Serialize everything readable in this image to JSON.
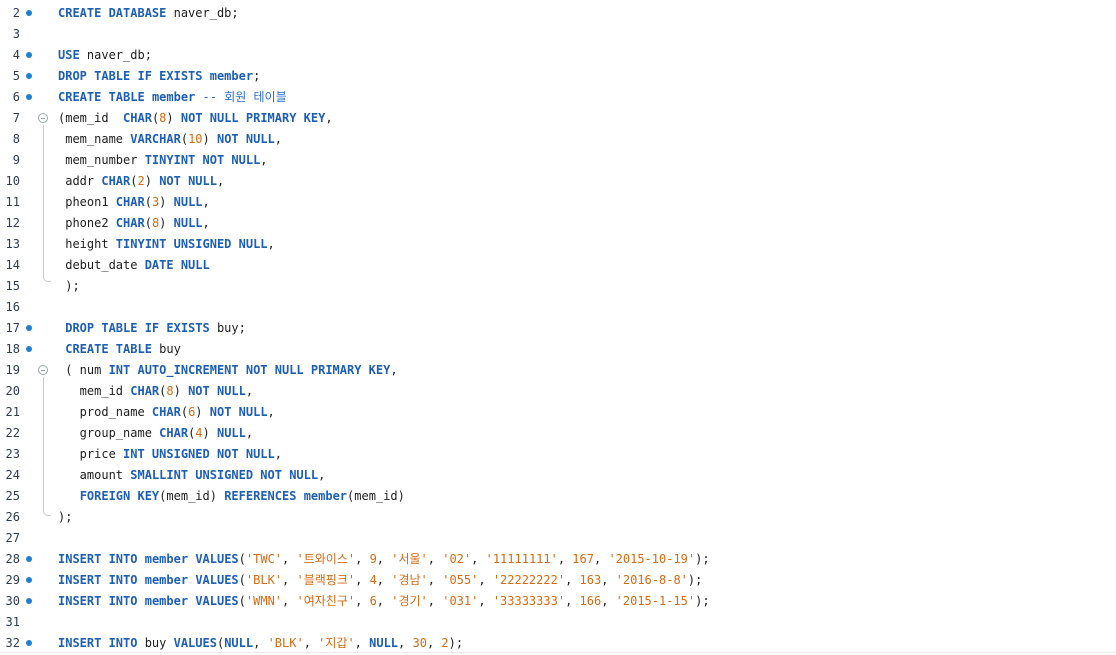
{
  "editor": {
    "lines": [
      {
        "n": "2",
        "tokens": [
          [
            "kw",
            "CREATE DATABASE"
          ],
          [
            "t",
            " naver_db;"
          ]
        ]
      },
      {
        "n": "3",
        "tokens": []
      },
      {
        "n": "4",
        "tokens": [
          [
            "kw",
            "USE"
          ],
          [
            "t",
            " naver_db;"
          ]
        ]
      },
      {
        "n": "5",
        "tokens": [
          [
            "kw",
            "DROP TABLE IF EXISTS"
          ],
          [
            "t",
            " "
          ],
          [
            "kw",
            "member"
          ],
          [
            "t",
            ";"
          ]
        ]
      },
      {
        "n": "6",
        "tokens": [
          [
            "kw",
            "CREATE TABLE"
          ],
          [
            "t",
            " "
          ],
          [
            "kw",
            "member"
          ],
          [
            "t",
            " "
          ],
          [
            "cm",
            "-- 회원 테이블"
          ]
        ]
      },
      {
        "n": "7",
        "tokens": [
          [
            "t",
            "(mem_id  "
          ],
          [
            "kw",
            "CHAR"
          ],
          [
            "t",
            "("
          ],
          [
            "num",
            "8"
          ],
          [
            "t",
            ") "
          ],
          [
            "kw",
            "NOT NULL PRIMARY KEY"
          ],
          [
            "t",
            ","
          ]
        ]
      },
      {
        "n": "8",
        "tokens": [
          [
            "t",
            " mem_name "
          ],
          [
            "kw",
            "VARCHAR"
          ],
          [
            "t",
            "("
          ],
          [
            "num",
            "10"
          ],
          [
            "t",
            ") "
          ],
          [
            "kw",
            "NOT NULL"
          ],
          [
            "t",
            ","
          ]
        ]
      },
      {
        "n": "9",
        "tokens": [
          [
            "t",
            " mem_number "
          ],
          [
            "kw",
            "TINYINT NOT NULL"
          ],
          [
            "t",
            ","
          ]
        ]
      },
      {
        "n": "10",
        "tokens": [
          [
            "t",
            " addr "
          ],
          [
            "kw",
            "CHAR"
          ],
          [
            "t",
            "("
          ],
          [
            "num",
            "2"
          ],
          [
            "t",
            ") "
          ],
          [
            "kw",
            "NOT NULL"
          ],
          [
            "t",
            ","
          ]
        ]
      },
      {
        "n": "11",
        "tokens": [
          [
            "t",
            " pheon1 "
          ],
          [
            "kw",
            "CHAR"
          ],
          [
            "t",
            "("
          ],
          [
            "num",
            "3"
          ],
          [
            "t",
            ") "
          ],
          [
            "kw",
            "NULL"
          ],
          [
            "t",
            ","
          ]
        ]
      },
      {
        "n": "12",
        "tokens": [
          [
            "t",
            " phone2 "
          ],
          [
            "kw",
            "CHAR"
          ],
          [
            "t",
            "("
          ],
          [
            "num",
            "8"
          ],
          [
            "t",
            ") "
          ],
          [
            "kw",
            "NULL"
          ],
          [
            "t",
            ","
          ]
        ]
      },
      {
        "n": "13",
        "tokens": [
          [
            "t",
            " height "
          ],
          [
            "kw",
            "TINYINT UNSIGNED NULL"
          ],
          [
            "t",
            ","
          ]
        ]
      },
      {
        "n": "14",
        "tokens": [
          [
            "t",
            " debut_date "
          ],
          [
            "kw",
            "DATE NULL"
          ]
        ]
      },
      {
        "n": "15",
        "tokens": [
          [
            "t",
            " );"
          ]
        ]
      },
      {
        "n": "16",
        "tokens": []
      },
      {
        "n": "17",
        "tokens": [
          [
            "t",
            " "
          ],
          [
            "kw",
            "DROP TABLE IF EXISTS"
          ],
          [
            "t",
            " buy;"
          ]
        ]
      },
      {
        "n": "18",
        "tokens": [
          [
            "t",
            " "
          ],
          [
            "kw",
            "CREATE TABLE"
          ],
          [
            "t",
            " buy"
          ]
        ]
      },
      {
        "n": "19",
        "tokens": [
          [
            "t",
            " ( num "
          ],
          [
            "kw",
            "INT AUTO_INCREMENT NOT NULL PRIMARY KEY"
          ],
          [
            "t",
            ","
          ]
        ]
      },
      {
        "n": "20",
        "tokens": [
          [
            "t",
            "   mem_id "
          ],
          [
            "kw",
            "CHAR"
          ],
          [
            "t",
            "("
          ],
          [
            "num",
            "8"
          ],
          [
            "t",
            ") "
          ],
          [
            "kw",
            "NOT NULL"
          ],
          [
            "t",
            ","
          ]
        ]
      },
      {
        "n": "21",
        "tokens": [
          [
            "t",
            "   prod_name "
          ],
          [
            "kw",
            "CHAR"
          ],
          [
            "t",
            "("
          ],
          [
            "num",
            "6"
          ],
          [
            "t",
            ") "
          ],
          [
            "kw",
            "NOT NULL"
          ],
          [
            "t",
            ","
          ]
        ]
      },
      {
        "n": "22",
        "tokens": [
          [
            "t",
            "   group_name "
          ],
          [
            "kw",
            "CHAR"
          ],
          [
            "t",
            "("
          ],
          [
            "num",
            "4"
          ],
          [
            "t",
            ") "
          ],
          [
            "kw",
            "NULL"
          ],
          [
            "t",
            ","
          ]
        ]
      },
      {
        "n": "23",
        "tokens": [
          [
            "t",
            "   price "
          ],
          [
            "kw",
            "INT UNSIGNED NOT NULL"
          ],
          [
            "t",
            ","
          ]
        ]
      },
      {
        "n": "24",
        "tokens": [
          [
            "t",
            "   amount "
          ],
          [
            "kw",
            "SMALLINT UNSIGNED NOT NULL"
          ],
          [
            "t",
            ","
          ]
        ]
      },
      {
        "n": "25",
        "tokens": [
          [
            "t",
            "   "
          ],
          [
            "kw",
            "FOREIGN KEY"
          ],
          [
            "t",
            "(mem_id) "
          ],
          [
            "kw",
            "REFERENCES"
          ],
          [
            "t",
            " "
          ],
          [
            "kw",
            "member"
          ],
          [
            "t",
            "(mem_id)"
          ]
        ]
      },
      {
        "n": "26",
        "tokens": [
          [
            "t",
            ");"
          ]
        ]
      },
      {
        "n": "27",
        "tokens": []
      },
      {
        "n": "28",
        "tokens": [
          [
            "kw",
            "INSERT INTO"
          ],
          [
            "t",
            " "
          ],
          [
            "kw",
            "member"
          ],
          [
            "t",
            " "
          ],
          [
            "kw",
            "VALUES"
          ],
          [
            "t",
            "("
          ],
          [
            "str",
            "'TWC'"
          ],
          [
            "t",
            ", "
          ],
          [
            "str",
            "'트와이스'"
          ],
          [
            "t",
            ", "
          ],
          [
            "num",
            "9"
          ],
          [
            "t",
            ", "
          ],
          [
            "str",
            "'서울'"
          ],
          [
            "t",
            ", "
          ],
          [
            "str",
            "'02'"
          ],
          [
            "t",
            ", "
          ],
          [
            "str",
            "'11111111'"
          ],
          [
            "t",
            ", "
          ],
          [
            "num",
            "167"
          ],
          [
            "t",
            ", "
          ],
          [
            "str",
            "'2015-10-19'"
          ],
          [
            "t",
            ");"
          ]
        ]
      },
      {
        "n": "29",
        "tokens": [
          [
            "kw",
            "INSERT INTO"
          ],
          [
            "t",
            " "
          ],
          [
            "kw",
            "member"
          ],
          [
            "t",
            " "
          ],
          [
            "kw",
            "VALUES"
          ],
          [
            "t",
            "("
          ],
          [
            "str",
            "'BLK'"
          ],
          [
            "t",
            ", "
          ],
          [
            "str",
            "'블랙핑크'"
          ],
          [
            "t",
            ", "
          ],
          [
            "num",
            "4"
          ],
          [
            "t",
            ", "
          ],
          [
            "str",
            "'경남'"
          ],
          [
            "t",
            ", "
          ],
          [
            "str",
            "'055'"
          ],
          [
            "t",
            ", "
          ],
          [
            "str",
            "'22222222'"
          ],
          [
            "t",
            ", "
          ],
          [
            "num",
            "163"
          ],
          [
            "t",
            ", "
          ],
          [
            "str",
            "'2016-8-8'"
          ],
          [
            "t",
            ");"
          ]
        ]
      },
      {
        "n": "30",
        "tokens": [
          [
            "kw",
            "INSERT INTO"
          ],
          [
            "t",
            " "
          ],
          [
            "kw",
            "member"
          ],
          [
            "t",
            " "
          ],
          [
            "kw",
            "VALUES"
          ],
          [
            "t",
            "("
          ],
          [
            "str",
            "'WMN'"
          ],
          [
            "t",
            ", "
          ],
          [
            "str",
            "'여자친구'"
          ],
          [
            "t",
            ", "
          ],
          [
            "num",
            "6"
          ],
          [
            "t",
            ", "
          ],
          [
            "str",
            "'경기'"
          ],
          [
            "t",
            ", "
          ],
          [
            "str",
            "'031'"
          ],
          [
            "t",
            ", "
          ],
          [
            "str",
            "'33333333'"
          ],
          [
            "t",
            ", "
          ],
          [
            "num",
            "166"
          ],
          [
            "t",
            ", "
          ],
          [
            "str",
            "'2015-1-15'"
          ],
          [
            "t",
            ");"
          ]
        ]
      },
      {
        "n": "31",
        "tokens": []
      },
      {
        "n": "32",
        "tokens": [
          [
            "kw",
            "INSERT INTO"
          ],
          [
            "t",
            " buy "
          ],
          [
            "kw",
            "VALUES"
          ],
          [
            "t",
            "("
          ],
          [
            "kw",
            "NULL"
          ],
          [
            "t",
            ", "
          ],
          [
            "str",
            "'BLK'"
          ],
          [
            "t",
            ", "
          ],
          [
            "str",
            "'지갑'"
          ],
          [
            "t",
            ", "
          ],
          [
            "kw",
            "NULL"
          ],
          [
            "t",
            ", "
          ],
          [
            "num",
            "30"
          ],
          [
            "t",
            ", "
          ],
          [
            "num",
            "2"
          ],
          [
            "t",
            ");"
          ]
        ]
      }
    ],
    "statement_markers": [
      "2",
      "4",
      "5",
      "6",
      "17",
      "18",
      "28",
      "29",
      "30",
      "32"
    ],
    "fold_markers": [
      "7",
      "19"
    ],
    "colors": {
      "keyword": "#1d5fb4",
      "literal": "#d56b12",
      "comment": "#2a6fc9",
      "marker": "#1f7fd1"
    }
  }
}
